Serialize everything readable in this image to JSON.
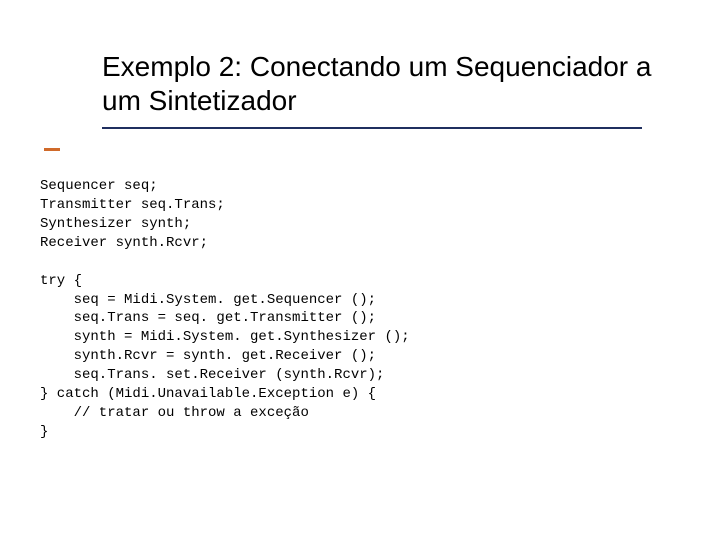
{
  "title": "Exemplo 2: Conectando um Sequenciador a um Sintetizador",
  "code": {
    "l1": "Sequencer seq;",
    "l2": "Transmitter seq.Trans;",
    "l3": "Synthesizer synth;",
    "l4": "Receiver synth.Rcvr;",
    "blank1": "",
    "l5": "try {",
    "l6": "    seq = Midi.System. get.Sequencer ();",
    "l7": "    seq.Trans = seq. get.Transmitter ();",
    "l8": "    synth = Midi.System. get.Synthesizer ();",
    "l9": "    synth.Rcvr = synth. get.Receiver ();",
    "l10": "    seq.Trans. set.Receiver (synth.Rcvr);",
    "l11": "} catch (Midi.Unavailable.Exception e) {",
    "l12": "    // tratar ou throw a exceção",
    "l13": "}"
  }
}
